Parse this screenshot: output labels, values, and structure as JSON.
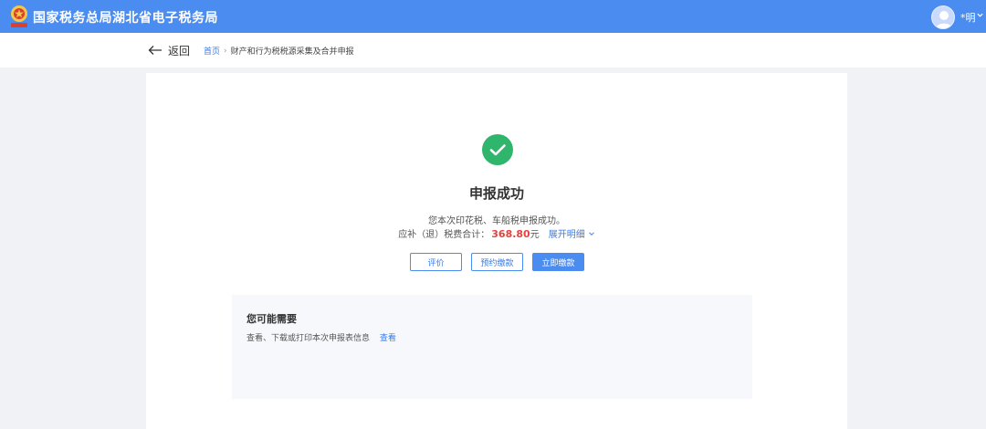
{
  "header": {
    "title": "国家税务总局湖北省电子税务局",
    "user_name": "*明",
    "brand_color": "#4a8cf0"
  },
  "nav": {
    "back_label": "返回",
    "breadcrumb": {
      "home": "首页",
      "separator": "›",
      "current": "财产和行为税税源采集及合并申报"
    }
  },
  "result": {
    "icon": "check-circle-icon",
    "success_color": "#2fb56c",
    "title": "申报成功",
    "description": "您本次印花税、车船税申报成功。",
    "total_label": "应补（退）税费合计：",
    "total_amount": "368.80",
    "total_unit": "元",
    "amount_color": "#e8413c",
    "expand_label": "展开明细"
  },
  "actions": {
    "evaluate": "评价",
    "reserve_pay": "预约缴款",
    "pay_now": "立即缴款"
  },
  "needs": {
    "title": "您可能需要",
    "item_text": "查看、下载或打印本次申报表信息",
    "item_link": "查看"
  }
}
